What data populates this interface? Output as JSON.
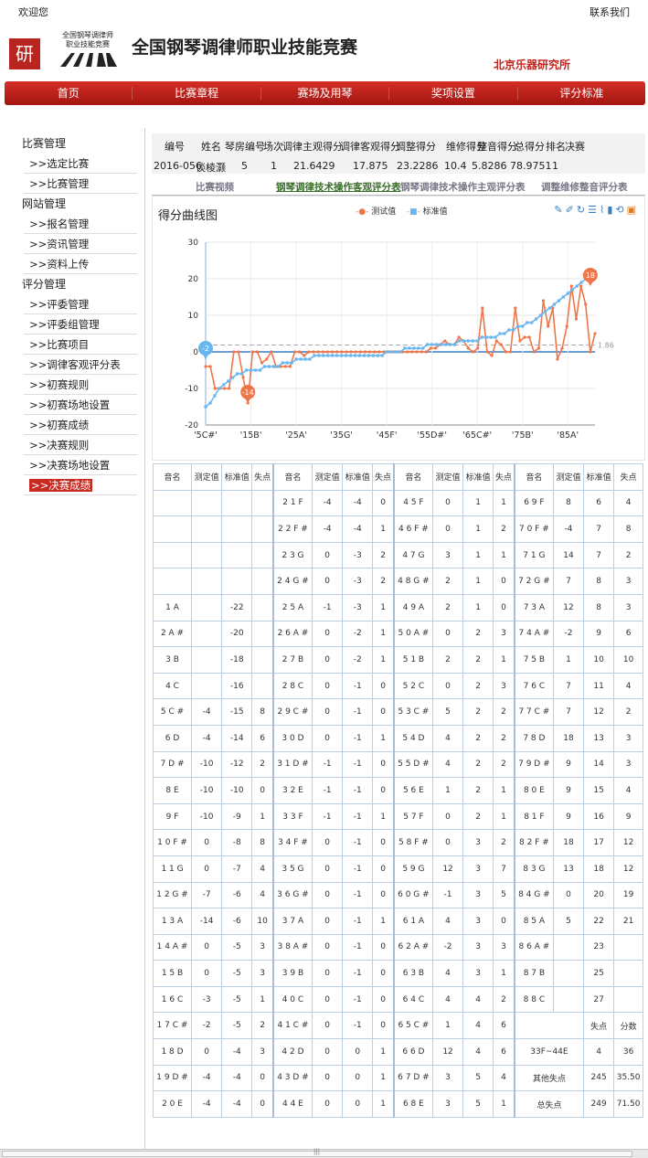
{
  "topbar": {
    "welcome": "欢迎您",
    "contact": "联系我们"
  },
  "logo": {
    "glyph": "研",
    "line1": "全国钢琴调律师",
    "line2": "职业技能竞赛"
  },
  "site": {
    "title": "全国钢琴调律师职业技能竞赛",
    "institute": "北京乐器研究所"
  },
  "nav": [
    "首页",
    "比赛章程",
    "赛场及用琴",
    "奖项设置",
    "评分标准"
  ],
  "sidebar": [
    {
      "group": "比赛管理",
      "items": [
        ">>选定比赛",
        ">>比赛管理"
      ]
    },
    {
      "group": "网站管理",
      "items": [
        ">>报名管理",
        ">>资讯管理",
        ">>资料上传"
      ]
    },
    {
      "group": "评分管理",
      "items": [
        ">>评委管理",
        ">>评委组管理",
        ">>比赛项目",
        ">>调律客观评分表",
        ">>初赛规则",
        ">>初赛场地设置",
        ">>初赛成绩",
        ">>决赛规则",
        ">>决赛场地设置",
        ">>决赛成绩"
      ]
    }
  ],
  "summary": {
    "headers": [
      "编号",
      "姓名",
      "琴房编号",
      "场次",
      "调律主观得分",
      "调律客观得分",
      "调整得分",
      "维修得分",
      "整音得分",
      "总得分",
      "排名",
      "决赛"
    ],
    "values": [
      "2016-056",
      "谈棱灏",
      "5",
      "1",
      "21.6429",
      "17.875",
      "23.2286",
      "10.4",
      "5.8286",
      "78.9751",
      "1",
      ""
    ]
  },
  "tabs": [
    "比赛视频",
    "钢琴调律技术操作客观评分表",
    "钢琴调律技术操作主观评分表",
    "调整维修整音评分表"
  ],
  "chart_title": "得分曲线图",
  "legend": [
    "测试值",
    "标准值"
  ],
  "chart_data": {
    "type": "line",
    "x_ticks": [
      "'5C#'",
      "'15B'",
      "'25A'",
      "'35G'",
      "'45F'",
      "'55D#'",
      "'65C#'",
      "'75B'",
      "'85A'"
    ],
    "ylim": [
      -20,
      30
    ],
    "y_ticks": [
      -20,
      -10,
      0,
      10,
      20,
      30
    ],
    "series": [
      {
        "name": "测试值",
        "color": "#f0764a",
        "values": [
          -4,
          -4,
          -10,
          -10,
          -10,
          -10,
          0,
          0,
          -7,
          -14,
          0,
          0,
          -3,
          -2,
          0,
          -4,
          -4,
          -4,
          -4,
          0,
          0,
          -1,
          0,
          0,
          0,
          0,
          0,
          0,
          0,
          0,
          0,
          0,
          0,
          0,
          0,
          0,
          0,
          0,
          0,
          0,
          0,
          0,
          0,
          0,
          0,
          0,
          0,
          0,
          1,
          1,
          2,
          3,
          2,
          2,
          4,
          3,
          1,
          0,
          1,
          12,
          0,
          -1,
          3,
          2,
          0,
          0,
          12,
          3,
          4,
          4,
          0,
          1,
          14,
          7,
          12,
          -2,
          1,
          7,
          18,
          9,
          18,
          13,
          0,
          5
        ]
      },
      {
        "name": "标准值",
        "color": "#67b6ee",
        "values": [
          -15,
          -14,
          -12,
          -10,
          -9,
          -8,
          -7,
          -6,
          -6,
          -5,
          -5,
          -5,
          -5,
          -4,
          -4,
          -4,
          -4,
          -3,
          -3,
          -3,
          -2,
          -2,
          -2,
          -2,
          -1,
          -1,
          -1,
          -1,
          -1,
          -1,
          -1,
          -1,
          -1,
          -1,
          -1,
          -1,
          -1,
          -1,
          -1,
          -1,
          0,
          0,
          0,
          0,
          1,
          1,
          1,
          1,
          1,
          2,
          2,
          2,
          2,
          2,
          2,
          2,
          3,
          3,
          3,
          3,
          3,
          4,
          4,
          4,
          4,
          5,
          5,
          6,
          6,
          7,
          7,
          8,
          8,
          9,
          10,
          11,
          12,
          13,
          14,
          15,
          16,
          17,
          18,
          19,
          20,
          21,
          22
        ]
      }
    ],
    "markers": [
      {
        "label": "-2"
      },
      {
        "label": "-14"
      },
      {
        "label": "18"
      }
    ],
    "avg_label": "1.86"
  },
  "grid": {
    "header": [
      "音名",
      "测定值",
      "标准值",
      "失点",
      "音名",
      "测定值",
      "标准值",
      "失点",
      "音名",
      "测定值",
      "标准值",
      "失点",
      "音名",
      "测定值",
      "标准值",
      "失点"
    ],
    "rows": [
      [
        "",
        "",
        "",
        "",
        "2 1 F",
        "-4",
        "-4",
        "0",
        "4 5 F",
        "0",
        "1",
        "1",
        "6 9 F",
        "8",
        "6",
        "4"
      ],
      [
        "",
        "",
        "",
        "",
        "2 2 F #",
        "-4",
        "-4",
        "1",
        "4 6 F #",
        "0",
        "1",
        "2",
        "7 0 F #",
        "-4",
        "7",
        "8"
      ],
      [
        "",
        "",
        "",
        "",
        "2 3 G",
        "0",
        "-3",
        "2",
        "4 7 G",
        "3",
        "1",
        "1",
        "7 1 G",
        "14",
        "7",
        "2"
      ],
      [
        "",
        "",
        "",
        "",
        "2 4 G #",
        "0",
        "-3",
        "2",
        "4 8 G #",
        "2",
        "1",
        "0",
        "7 2 G #",
        "7",
        "8",
        "3"
      ],
      [
        "1 A",
        "",
        "-22",
        "",
        "2 5 A",
        "-1",
        "-3",
        "1",
        "4 9 A",
        "2",
        "1",
        "0",
        "7 3 A",
        "12",
        "8",
        "3"
      ],
      [
        "2 A #",
        "",
        "-20",
        "",
        "2 6 A #",
        "0",
        "-2",
        "1",
        "5 0 A #",
        "0",
        "2",
        "3",
        "7 4 A #",
        "-2",
        "9",
        "6"
      ],
      [
        "3 B",
        "",
        "-18",
        "",
        "2 7 B",
        "0",
        "-2",
        "1",
        "5 1 B",
        "2",
        "2",
        "1",
        "7 5 B",
        "1",
        "10",
        "10"
      ],
      [
        "4 C",
        "",
        "-16",
        "",
        "2 8 C",
        "0",
        "-1",
        "0",
        "5 2 C",
        "0",
        "2",
        "3",
        "7 6 C",
        "7",
        "11",
        "4"
      ],
      [
        "5 C #",
        "-4",
        "-15",
        "8",
        "2 9 C #",
        "0",
        "-1",
        "0",
        "5 3 C #",
        "5",
        "2",
        "2",
        "7 7 C #",
        "7",
        "12",
        "2"
      ],
      [
        "6 D",
        "-4",
        "-14",
        "6",
        "3 0 D",
        "0",
        "-1",
        "1",
        "5 4 D",
        "4",
        "2",
        "2",
        "7 8 D",
        "18",
        "13",
        "3"
      ],
      [
        "7 D #",
        "-10",
        "-12",
        "2",
        "3 1 D #",
        "-1",
        "-1",
        "0",
        "5 5 D #",
        "4",
        "2",
        "2",
        "7 9 D #",
        "9",
        "14",
        "3"
      ],
      [
        "8 E",
        "-10",
        "-10",
        "0",
        "3 2 E",
        "-1",
        "-1",
        "0",
        "5 6 E",
        "1",
        "2",
        "1",
        "8 0 E",
        "9",
        "15",
        "4"
      ],
      [
        "9 F",
        "-10",
        "-9",
        "1",
        "3 3 F",
        "-1",
        "-1",
        "1",
        "5 7 F",
        "0",
        "2",
        "1",
        "8 1 F",
        "9",
        "16",
        "9"
      ],
      [
        "1 0 F #",
        "0",
        "-8",
        "8",
        "3 4 F #",
        "0",
        "-1",
        "0",
        "5 8 F #",
        "0",
        "3",
        "2",
        "8 2 F #",
        "18",
        "17",
        "12"
      ],
      [
        "1 1 G",
        "0",
        "-7",
        "4",
        "3 5 G",
        "0",
        "-1",
        "0",
        "5 9 G",
        "12",
        "3",
        "7",
        "8 3 G",
        "13",
        "18",
        "12"
      ],
      [
        "1 2 G #",
        "-7",
        "-6",
        "4",
        "3 6 G #",
        "0",
        "-1",
        "0",
        "6 0 G #",
        "-1",
        "3",
        "5",
        "8 4 G #",
        "0",
        "20",
        "19"
      ],
      [
        "1 3 A",
        "-14",
        "-6",
        "10",
        "3 7 A",
        "0",
        "-1",
        "1",
        "6 1 A",
        "4",
        "3",
        "0",
        "8 5 A",
        "5",
        "22",
        "21"
      ],
      [
        "1 4 A #",
        "0",
        "-5",
        "3",
        "3 8 A #",
        "0",
        "-1",
        "0",
        "6 2 A #",
        "-2",
        "3",
        "3",
        "8 6 A #",
        "",
        "23",
        ""
      ],
      [
        "1 5 B",
        "0",
        "-5",
        "3",
        "3 9 B",
        "0",
        "-1",
        "0",
        "6 3 B",
        "4",
        "3",
        "1",
        "8 7 B",
        "",
        "25",
        ""
      ],
      [
        "1 6 C",
        "-3",
        "-5",
        "1",
        "4 0 C",
        "0",
        "-1",
        "0",
        "6 4 C",
        "4",
        "4",
        "2",
        "8 8 C",
        "",
        "27",
        ""
      ]
    ],
    "tail": [
      [
        "1 7 C #",
        "-2",
        "-5",
        "2",
        "4 1 C #",
        "0",
        "-1",
        "0",
        "6 5 C #",
        "1",
        "4",
        "6",
        "",
        "失点",
        "分数"
      ],
      [
        "1 8 D",
        "0",
        "-4",
        "3",
        "4 2 D",
        "0",
        "0",
        "1",
        "6 6 D",
        "12",
        "4",
        "6",
        "33F~44E",
        "4",
        "36"
      ],
      [
        "1 9 D #",
        "-4",
        "-4",
        "0",
        "4 3 D #",
        "0",
        "0",
        "1",
        "6 7 D #",
        "3",
        "5",
        "4",
        "其他失点",
        "245",
        "35.50"
      ],
      [
        "2 0 E",
        "-4",
        "-4",
        "0",
        "4 4 E",
        "0",
        "0",
        "1",
        "6 8 E",
        "3",
        "5",
        "1",
        "总失点",
        "249",
        "71.50"
      ]
    ]
  }
}
